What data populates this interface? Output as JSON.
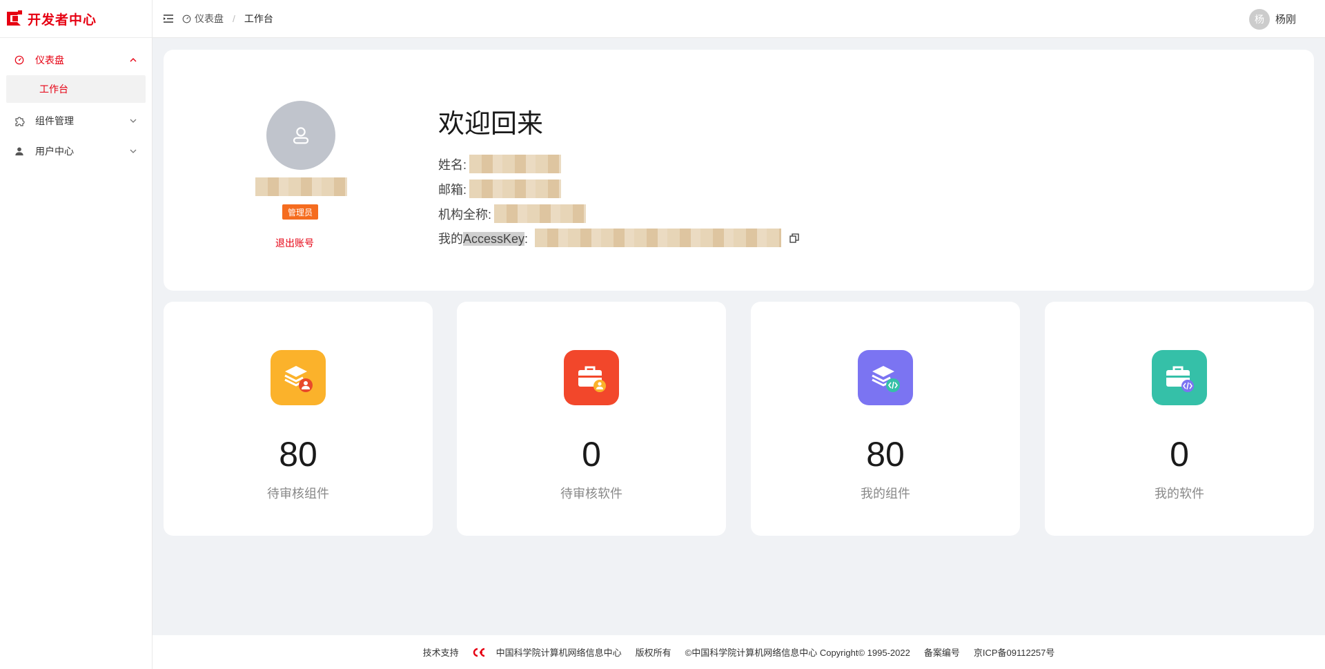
{
  "app": {
    "logo_text": "开发者中心",
    "brand_color": "#e60012"
  },
  "sidebar": {
    "items": [
      {
        "label": "仪表盘",
        "icon": "dashboard-icon",
        "expanded": true
      },
      {
        "label": "工作台",
        "sub": true,
        "active": true
      },
      {
        "label": "组件管理",
        "icon": "puzzle-icon",
        "expanded": false
      },
      {
        "label": "用户中心",
        "icon": "user-icon",
        "expanded": false
      }
    ]
  },
  "header": {
    "breadcrumb": [
      "仪表盘",
      "工作台"
    ],
    "separator": "/",
    "user_initial": "杨",
    "user_name": "杨刚"
  },
  "profile": {
    "welcome": "欢迎回来",
    "role": "管理员",
    "logout": "退出账号",
    "fields": {
      "name_label": "姓名:",
      "email_label": "邮箱:",
      "org_label": "机构全称:",
      "key_label_prefix": "我的",
      "key_label_highlight": "AccessKey",
      "key_label_suffix": ":"
    }
  },
  "stats": [
    {
      "value": "80",
      "label": "待审核组件",
      "color": "#fbb22b",
      "icon": "layers-user-icon"
    },
    {
      "value": "0",
      "label": "待审核软件",
      "color": "#f2472b",
      "icon": "briefcase-user-icon"
    },
    {
      "value": "80",
      "label": "我的组件",
      "color": "#7b74f2",
      "icon": "layers-code-icon"
    },
    {
      "value": "0",
      "label": "我的软件",
      "color": "#35c0a8",
      "icon": "briefcase-code-icon"
    }
  ],
  "footer": {
    "support_label": "技术支持",
    "support_org": "中国科学院计算机网络信息中心",
    "copyright_label": "版权所有",
    "copyright_text": "©中国科学院计算机网络信息中心 Copyright© 1995-2022",
    "icp_label": "备案编号",
    "icp_value": "京ICP备09112257号"
  }
}
